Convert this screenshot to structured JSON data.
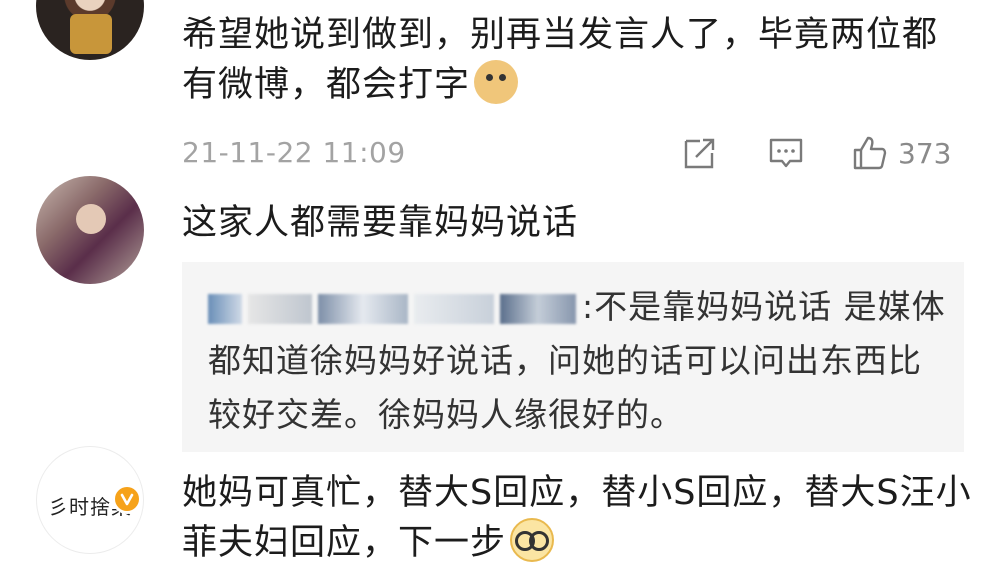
{
  "comments": [
    {
      "text": "希望她说到做到，别再当发言人了，毕竟两位都有微博，都会打字",
      "emoji": "doge-emoji",
      "timestamp": "21-11-22 11:09",
      "likes": "373"
    },
    {
      "text": "这家人都需要靠妈妈说话",
      "reply": {
        "author_redacted": true,
        "separator": ":",
        "text": "不是靠妈妈说话  是媒体都知道徐妈妈好说话，问她的话可以问出东西比较好交差。徐妈妈人缘很好的。"
      }
    },
    {
      "avatar_text": "彡时捨菜",
      "verified": true,
      "text": "她妈可真忙，替大S回应，替小S回应，替大S汪小菲夫妇回应，下一步",
      "emoji": "glasses-emoji"
    }
  ],
  "colors": {
    "background": "#ffffff",
    "text": "#1c1c1c",
    "meta": "#a3a3a3",
    "reply_bg": "#f5f5f5",
    "verified_badge": "#f6a21a"
  }
}
